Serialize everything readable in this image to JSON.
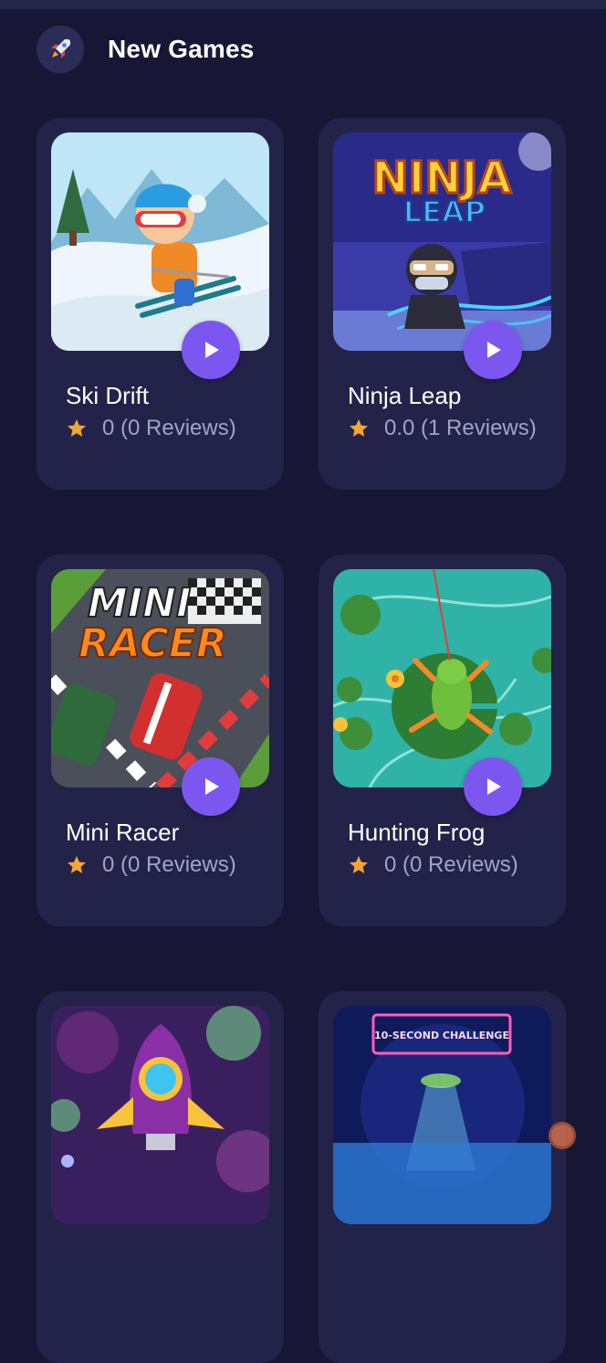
{
  "header": {
    "title": "New Games",
    "icon": "rocket-icon"
  },
  "games": [
    {
      "title": "Ski Drift",
      "rating": "0",
      "reviews": "(0 Reviews)"
    },
    {
      "title": "Ninja Leap",
      "rating": "0.0",
      "reviews": "(1 Reviews)"
    },
    {
      "title": "Mini Racer",
      "rating": "0",
      "reviews": "(0 Reviews)"
    },
    {
      "title": "Hunting Frog",
      "rating": "0",
      "reviews": "(0 Reviews)"
    },
    {
      "title": "",
      "rating": "",
      "reviews": ""
    },
    {
      "title": "",
      "rating": "",
      "reviews": ""
    }
  ],
  "thumbnails": {
    "ninja_logo_line1": "NINJA",
    "ninja_logo_line2": "LEAP",
    "racer_logo_line1": "MINI",
    "racer_logo_line2": "RACER",
    "challenge_banner": "10-SECOND CHALLENGE"
  },
  "colors": {
    "background": "#171735",
    "card": "#232349",
    "play_button": "#7b57f0",
    "star": "#f7a534",
    "muted_text": "#a3a3c6"
  }
}
